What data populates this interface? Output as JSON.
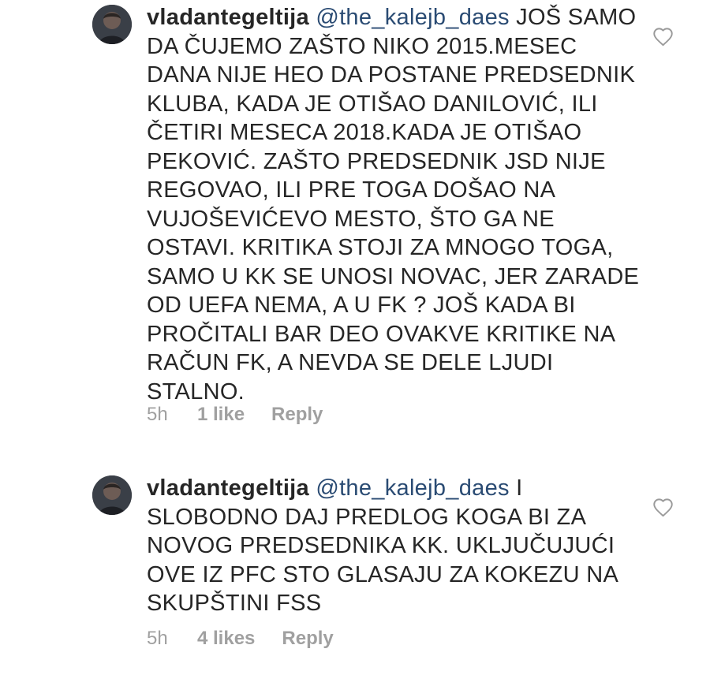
{
  "comments": [
    {
      "username": "vladantegeltija",
      "mention": "@the_kalejb_daes",
      "text": " JOŠ SAMO DA ČUJEMO ZAŠTO NIKO 2015.MESEC DANA NIJE HEO DA POSTANE PREDSEDNIK KLUBA, KADA JE OTIŠAO DANILOVIĆ, ILI ČETIRI MESECA 2018.KADA JE OTIŠAO PEKOVIĆ. ZAŠTO PREDSEDNIK JSD NIJE REGOVAO, ILI PRE TOGA DOŠAO NA VUJOŠEVIĆEVO MESTO, ŠTO GA NE OSTAVI. KRITIKA STOJI ZA MNOGO TOGA, SAMO U KK SE UNOSI NOVAC, JER ZARADE OD UEFA NEMA, A U FK ? JOŠ KADA BI PROČITALI BAR DEO OVAKVE KRITIKE NA RAČUN FK, A NEVDA SE DELE LJUDI STALNO.",
      "time": "5h",
      "likes": "1 like",
      "reply": "Reply",
      "avatar_icon": "user-avatar",
      "like_icon": "heart-outline-icon"
    },
    {
      "username": "vladantegeltija",
      "mention": "@the_kalejb_daes",
      "text": " I SLOBODNO DAJ PREDLOG KOGA BI ZA NOVOG PREDSEDNIKA KK. UKLJUČUJUĆI OVE IZ PFC STO GLASAJU ZA KOKEZU NA SKUPŠTINI FSS",
      "time": "5h",
      "likes": "4 likes",
      "reply": "Reply",
      "avatar_icon": "user-avatar",
      "like_icon": "heart-outline-icon"
    }
  ],
  "colors": {
    "text": "#262626",
    "mention": "#2a4b73",
    "meta": "#a0a0a0",
    "background": "#ffffff"
  }
}
